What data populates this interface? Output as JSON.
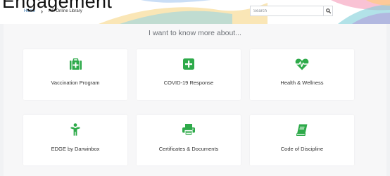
{
  "page": {
    "overlay_title": "Engagement"
  },
  "breadcrumb": {
    "home": "Home",
    "current": "HR Online Library"
  },
  "search": {
    "placeholder": "Search"
  },
  "main": {
    "heading": "I want to know more about...",
    "accent_color": "#2eaa4a",
    "cards": [
      {
        "label": "Vaccination Program",
        "icon": "medical-kit-icon"
      },
      {
        "label": "COVID-19 Response",
        "icon": "plus-square-icon"
      },
      {
        "label": "Health & Wellness",
        "icon": "heartbeat-icon"
      },
      {
        "label": "EDGE by Darwinbox",
        "icon": "person-icon"
      },
      {
        "label": "Certificates & Documents",
        "icon": "printer-icon"
      },
      {
        "label": "Code of Discipline",
        "icon": "book-icon"
      }
    ]
  }
}
